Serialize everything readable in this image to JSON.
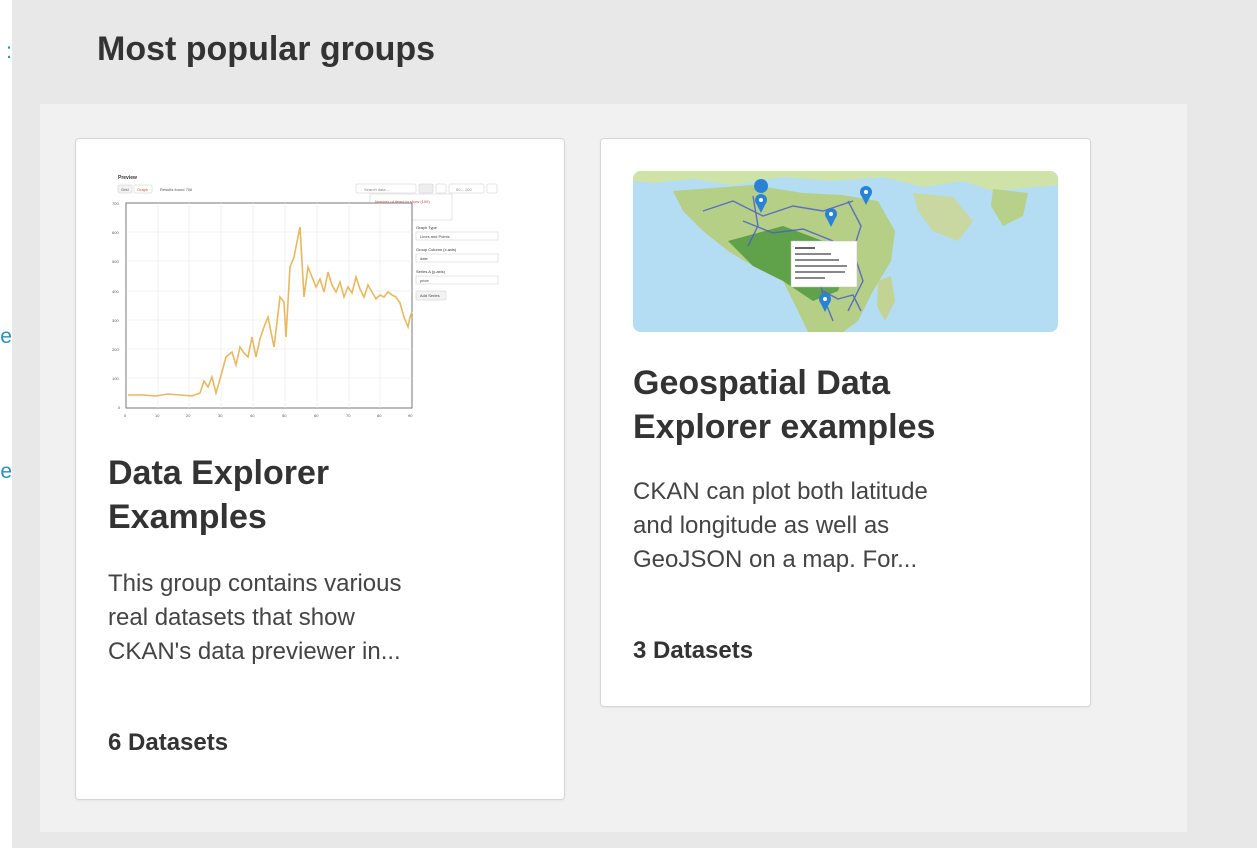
{
  "left_fragments": [
    ":",
    "re",
    "ure"
  ],
  "section": {
    "title": "Most popular groups"
  },
  "groups": [
    {
      "title_line1": "Data Explorer",
      "title_line2": "Examples",
      "desc": [
        "This group contains various",
        "real datasets that show",
        "CKAN's data previewer in..."
      ],
      "count": "6 Datasets",
      "thumbnail": "data-previewer-graph-screenshot"
    },
    {
      "title_line1": "Geospatial Data",
      "title_line2": "Explorer examples",
      "desc": [
        "CKAN can plot both latitude",
        "and longitude as well as",
        "GeoJSON on a map. For..."
      ],
      "count": "3 Datasets",
      "thumbnail": "africa-map-screenshot"
    }
  ],
  "preview": {
    "heading": "Preview",
    "btn_grid": "Grid",
    "btn_graph": "Graph",
    "results": "Results found 706",
    "search_placeholder": "Search data ...",
    "range": "50 – 100",
    "dropdown_item_1": "Number of items to show (100)",
    "dropdown_item_2": "Show from (50)",
    "graph_type_label": "Graph Type",
    "graph_type_value": "Lines and Points",
    "group_col_label": "Group Column (x-axis)",
    "group_col_value": "date",
    "series_label": "Series A (y-axis)",
    "series_value": "price",
    "add_series": "Add Series"
  },
  "colors": {
    "link": "#2a8fbd",
    "line": "#e6b960",
    "marker": "#2a82d6",
    "page_bg": "#e8e8e8"
  }
}
